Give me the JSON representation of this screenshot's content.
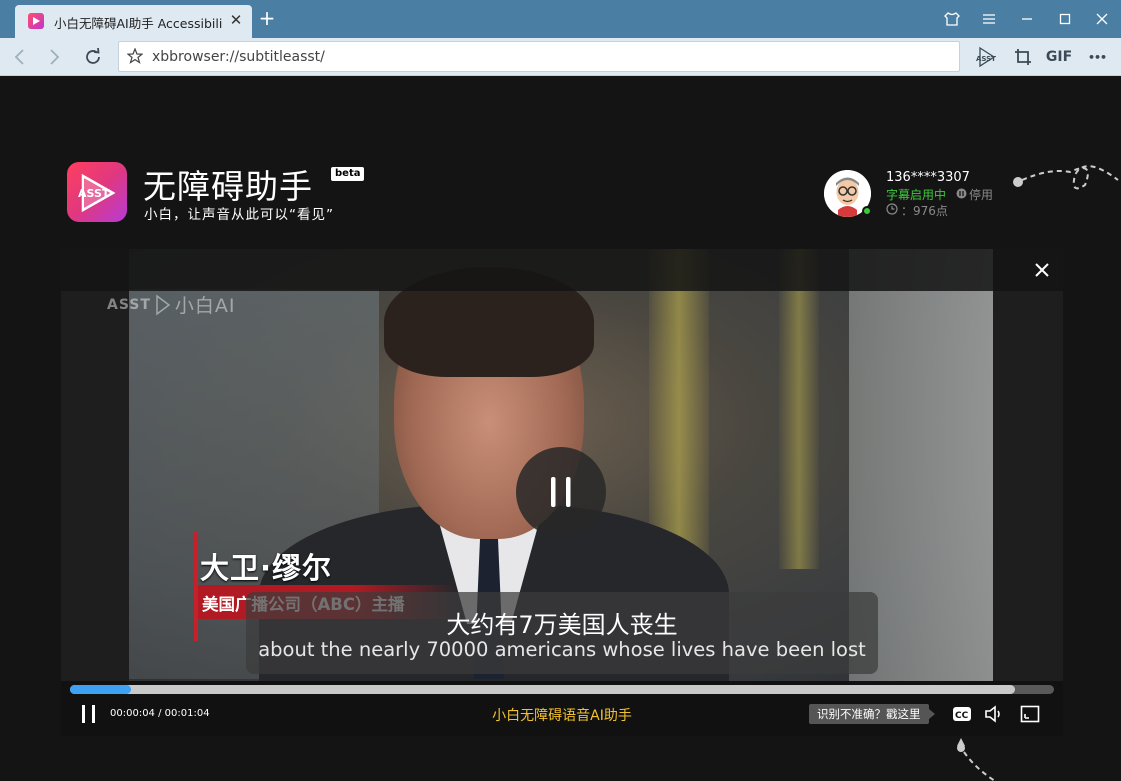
{
  "browser": {
    "tab_title": "小白无障碍AI助手 Accessibility",
    "tab_close": "✕",
    "new_tab": "+",
    "url": "xbbrowser://subtitleasst/",
    "tools": {
      "asst_label": "ASST",
      "gif_label": "GIF",
      "more_label": "•••"
    }
  },
  "app": {
    "logo_text": "ASST",
    "name": "无障碍助手",
    "beta": "beta",
    "slogan": "小白，让声音从此可以“看见”"
  },
  "user": {
    "phone": "136****3307",
    "status_active": "字幕启用中",
    "status_disable": "停用",
    "points": "：976点"
  },
  "player": {
    "watermark_asst": "ASST",
    "watermark_text": "小白AI",
    "close": "✕",
    "lower_third_name": "大卫·缪尔",
    "lower_third_title": "美国广播公司（ABC）主播",
    "subtitle_cn": "大约有7万美国人丧生",
    "subtitle_en": "about the nearly 70000 americans whose lives have been lost",
    "time": "00:00:04 / 00:01:04",
    "brand": "小白无障碍语音AI助手",
    "feedback": "识别不准确？戳这里",
    "cc_label": "CC",
    "progress_played": 0.062,
    "progress_buffered": 0.96
  },
  "colors": {
    "accent_blue": "#3ea1f2",
    "brand_yellow": "#f2c230",
    "status_green": "#3bc93b",
    "chrome_blue": "#4a7fa3"
  }
}
